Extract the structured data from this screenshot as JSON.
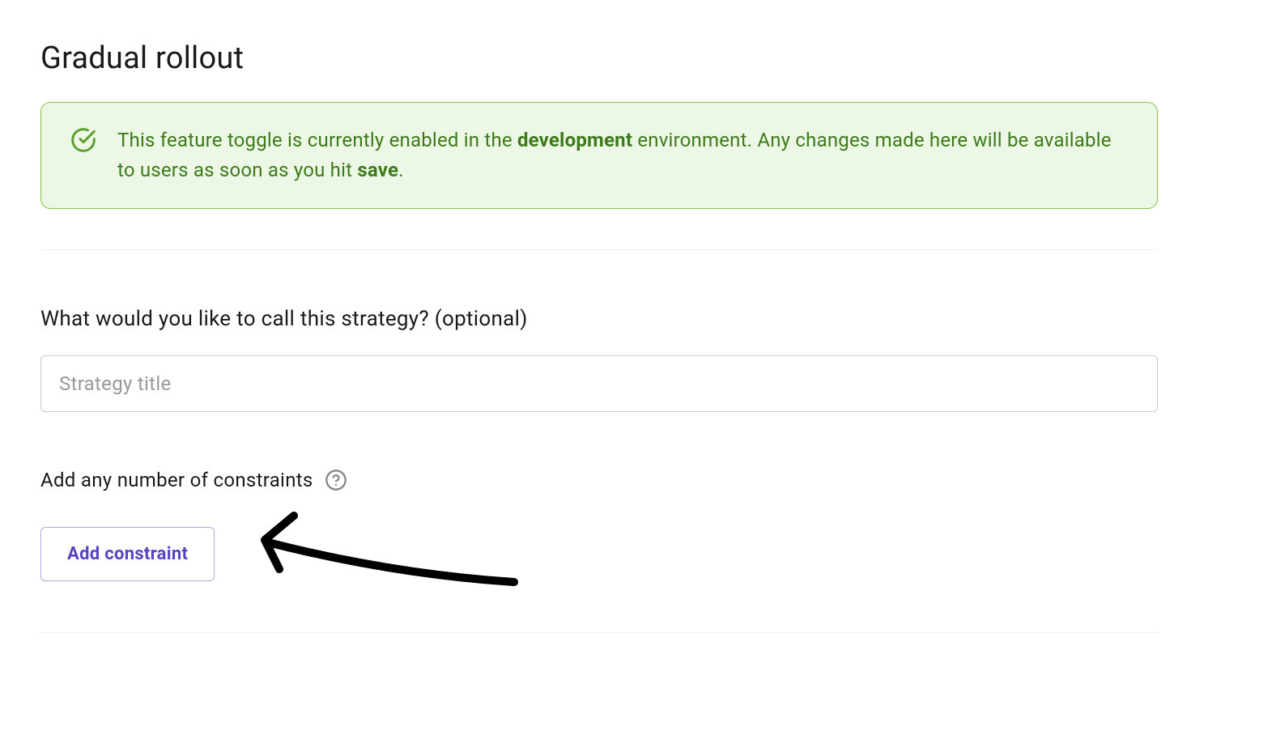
{
  "page": {
    "title": "Gradual rollout"
  },
  "alert": {
    "text_prefix": "This feature toggle is currently enabled in the ",
    "environment": "development",
    "text_middle": " environment. Any changes made here will be available to users as soon as you hit ",
    "action_word": "save",
    "text_suffix": "."
  },
  "strategy_title": {
    "label": "What would you like to call this strategy? (optional)",
    "placeholder": "Strategy title",
    "value": ""
  },
  "constraints": {
    "label": "Add any number of constraints",
    "add_button_label": "Add constraint"
  }
}
